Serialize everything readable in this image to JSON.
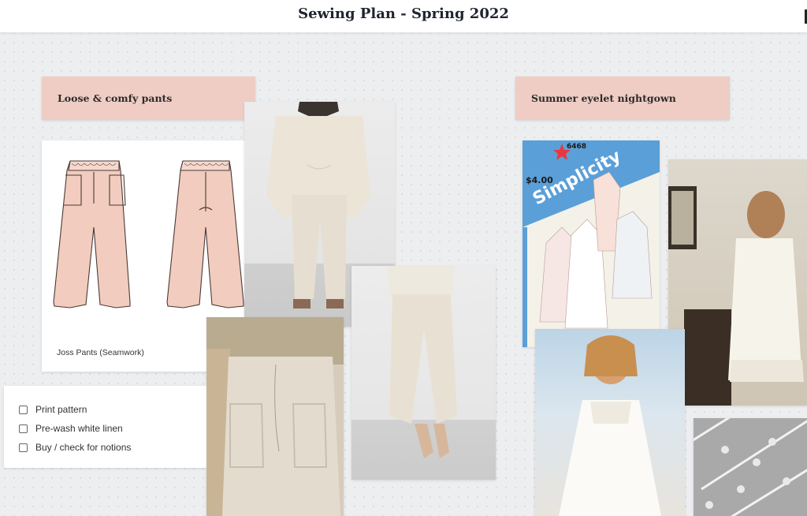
{
  "board": {
    "title": "Sewing Plan - Spring 2022"
  },
  "sections": {
    "pants": {
      "label": "Loose & comfy pants"
    },
    "nightgown": {
      "label": "Summer eyelet nightgown"
    }
  },
  "pattern_card": {
    "caption": "Joss Pants (Seamwork)"
  },
  "checklist": {
    "items": [
      {
        "label": "Print pattern",
        "checked": false
      },
      {
        "label": "Pre-wash white linen",
        "checked": false
      },
      {
        "label": "Buy / check for notions",
        "checked": false
      }
    ]
  },
  "envelope": {
    "brand": "Simplicity",
    "number": "6468",
    "price": "$4.00"
  },
  "colors": {
    "label_bg": "#efcdc4",
    "pants_fill": "#f2ccbe",
    "linen": "#e9e2d6"
  }
}
